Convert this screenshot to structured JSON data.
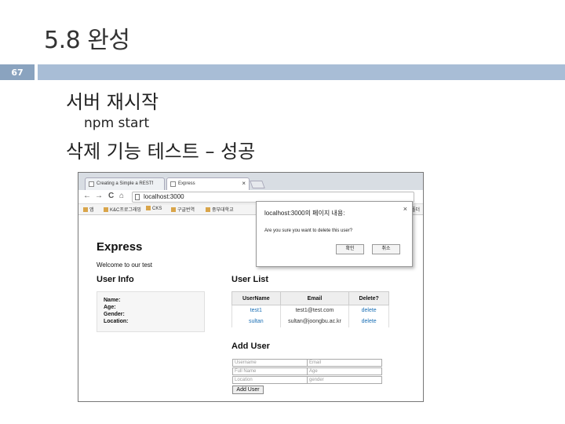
{
  "slide": {
    "title": "5.8 완성",
    "page_number": "67",
    "bullet_glyph": "",
    "items": [
      {
        "level": 1,
        "text": "서버 재시작"
      },
      {
        "level": 2,
        "text": "npm start"
      },
      {
        "level": 1,
        "text": "삭제 기능 테스트 – 성공"
      }
    ]
  },
  "browser": {
    "tabs": [
      {
        "label": "Creating a Simple a RESTf",
        "active": false
      },
      {
        "label": "Express",
        "active": true
      }
    ],
    "tab_close": "×",
    "nav": {
      "back": "←",
      "forward": "→",
      "reload": "C",
      "home": "⌂"
    },
    "url": "localhost:3000",
    "bookmarks": [
      "앱",
      "K&C프로그래밍",
      "CKS",
      "구글번역",
      "중부대학교"
    ],
    "bookmarks_right": "폴더",
    "page": {
      "title": "Express",
      "welcome": "Welcome to our test",
      "user_info": {
        "heading": "User Info",
        "fields": [
          "Name:",
          "Age:",
          "Gender:",
          "Location:"
        ]
      },
      "user_list": {
        "heading": "User List",
        "columns": [
          "UserName",
          "Email",
          "Delete?"
        ],
        "rows": [
          {
            "username": "test1",
            "email": "test1@test.com",
            "action": "delete"
          },
          {
            "username": "sultan",
            "email": "sultan@joongbu.ac.kr",
            "action": "delete"
          }
        ]
      },
      "add_user": {
        "heading": "Add User",
        "placeholders": [
          "Username",
          "Email",
          "Full Name",
          "Age",
          "Location",
          "gender"
        ],
        "button": "Add User"
      }
    },
    "dialog": {
      "title": "localhost:3000의 페이지 내용:",
      "message": "Are you sure you want to delete this user?",
      "ok": "확인",
      "cancel": "취소",
      "close": "×"
    }
  }
}
